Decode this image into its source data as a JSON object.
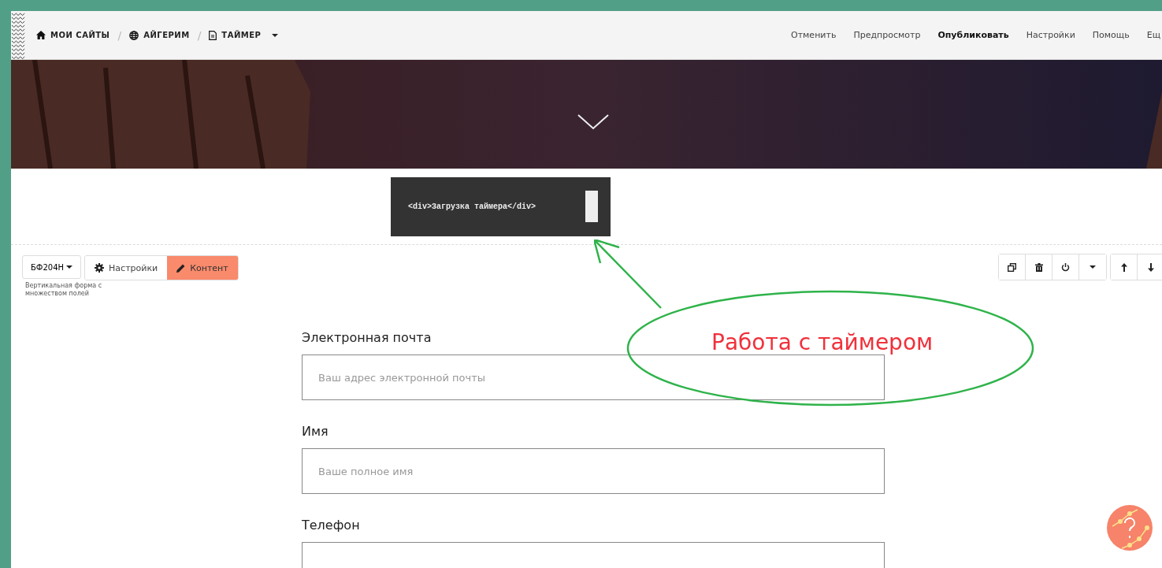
{
  "breadcrumbs": [
    {
      "label": "МОИ САЙТЫ"
    },
    {
      "separator": "/",
      "label": "АЙГЕРИМ"
    },
    {
      "separator": "/",
      "label": "ТАЙМЕР"
    }
  ],
  "top_menu": [
    {
      "label": "Отменить",
      "selected": false
    },
    {
      "label": "Предпросмотр",
      "selected": false
    },
    {
      "label": "Опубликовать",
      "selected": true
    },
    {
      "label": "Настройки",
      "selected": false
    },
    {
      "label": "Помощь",
      "selected": false
    },
    {
      "label": "Ещ",
      "selected": false
    }
  ],
  "code_block": {
    "text": "<div>Загрузка таймера</div>"
  },
  "block_toolbar": {
    "block_id": "БФ204Н",
    "tabs": [
      {
        "label": "Настройки",
        "selected": false
      },
      {
        "label": "Контент",
        "selected": true
      }
    ],
    "description": "Вертикальная форма с множеством полей"
  },
  "annotation": {
    "text": "Работа с таймером"
  },
  "form": {
    "fields": [
      {
        "label": "Электронная почта",
        "placeholder": "Ваш адрес электронной почты"
      },
      {
        "label": "Имя",
        "placeholder": "Ваше полное имя"
      },
      {
        "label": "Телефон"
      }
    ]
  }
}
